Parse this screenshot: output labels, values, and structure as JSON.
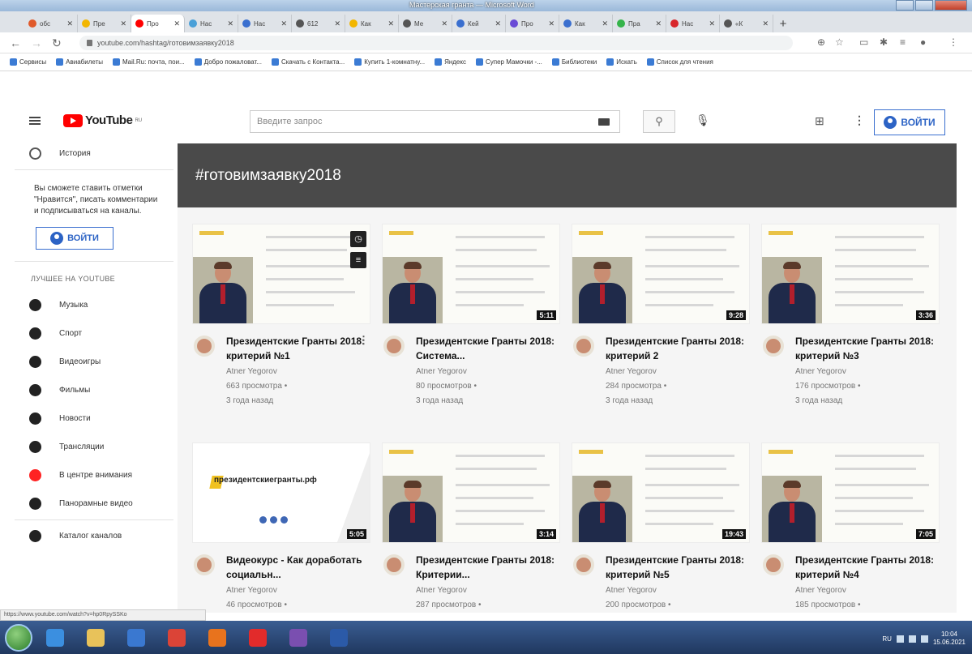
{
  "window": {
    "title": "Мастерская гранта — Microsoft Word"
  },
  "browser_tabs": [
    {
      "label": "oбс",
      "color": "#e05a2b"
    },
    {
      "label": "Пре",
      "color": "#f2b600"
    },
    {
      "label": "Про",
      "color": "#ff0000",
      "active": true
    },
    {
      "label": "Нас",
      "color": "#4aa0d8"
    },
    {
      "label": "Нас",
      "color": "#3a6fcf"
    },
    {
      "label": "612",
      "color": "#555555"
    },
    {
      "label": "Как",
      "color": "#f2b600"
    },
    {
      "label": "Ме",
      "color": "#555555"
    },
    {
      "label": "Кей",
      "color": "#3a6fcf"
    },
    {
      "label": "Про",
      "color": "#6a4bd6"
    },
    {
      "label": "Как",
      "color": "#3a6fcf"
    },
    {
      "label": "Пра",
      "color": "#35b44a"
    },
    {
      "label": "Нас",
      "color": "#d8262b"
    },
    {
      "label": "«К",
      "color": "#555555"
    }
  ],
  "address": {
    "url": "youtube.com/hashtag/готовимзаявку2018"
  },
  "bookmarks": [
    "Сервисы",
    "Авиабилеты",
    "Mail.Ru: почта, пои...",
    "Добро пожаловат...",
    "Скачать с Контакта...",
    "Купить 1-комнатну...",
    "Яндекс",
    "Супер Мамочки -...",
    "Библиотеки",
    "Искать",
    "Список для чтения"
  ],
  "youtube": {
    "logo": "YouTube",
    "logo_region": "RU",
    "search_placeholder": "Введите запрос",
    "login_label": "ВОЙТИ"
  },
  "sidebar": {
    "history_label": "История",
    "signin_text": "Вы сможете ставить отметки \"Нравится\", писать комментарии и подписываться на каналы.",
    "signin_button": "ВОЙТИ",
    "best_header": "ЛУЧШЕЕ НА YOUTUBE",
    "items": [
      {
        "label": "Музыка",
        "icon": "music-icon"
      },
      {
        "label": "Спорт",
        "icon": "sport-icon"
      },
      {
        "label": "Видеоигры",
        "icon": "gaming-icon"
      },
      {
        "label": "Фильмы",
        "icon": "movies-icon"
      },
      {
        "label": "Новости",
        "icon": "news-icon"
      },
      {
        "label": "Трансляции",
        "icon": "live-icon"
      },
      {
        "label": "В центре внимания",
        "icon": "spotlight-icon"
      },
      {
        "label": "Панорамные видео",
        "icon": "360-icon"
      }
    ],
    "catalog_label": "Каталог каналов"
  },
  "hashtag": "#готовимзаявку2018",
  "videos": [
    {
      "title": "Президентские Гранты 2018: критерий №1",
      "channel": "Atner Yegorov",
      "views": "663 просмотра •",
      "age": "3 года назад",
      "duration": ""
    },
    {
      "title": "Президентские Гранты 2018: Система...",
      "channel": "Atner Yegorov",
      "views": "80 просмотров •",
      "age": "3 года назад",
      "duration": "5:11"
    },
    {
      "title": "Президентские Гранты 2018: критерий 2",
      "channel": "Atner Yegorov",
      "views": "284 просмотра •",
      "age": "3 года назад",
      "duration": "9:28"
    },
    {
      "title": "Президентские Гранты 2018: критерий №3",
      "channel": "Atner Yegorov",
      "views": "176 просмотров •",
      "age": "3 года назад",
      "duration": "3:36"
    },
    {
      "title": "Видеокурс - Как доработать социальн...",
      "channel": "Atner Yegorov",
      "views": "46 просмотров •",
      "age": "",
      "duration": "5:05"
    },
    {
      "title": "Президентские Гранты 2018: Критерии...",
      "channel": "Atner Yegorov",
      "views": "287 просмотров •",
      "age": "",
      "duration": "3:14"
    },
    {
      "title": "Президентские Гранты 2018: критерий №5",
      "channel": "Atner Yegorov",
      "views": "200 просмотров •",
      "age": "",
      "duration": "19:43"
    },
    {
      "title": "Президентские Гранты 2018: критерий №4",
      "channel": "Atner Yegorov",
      "views": "185 просмотров •",
      "age": "",
      "duration": "7:05"
    }
  ],
  "promo_slide_text": "президентскиегранты.рф",
  "status_url": "https://www.youtube.com/watch?v=hp0RpySSKo",
  "taskbar": {
    "icons": [
      {
        "name": "ie-icon",
        "color": "#3b8fe0"
      },
      {
        "name": "explorer-icon",
        "color": "#e8c25a"
      },
      {
        "name": "media-icon",
        "color": "#3a78d0"
      },
      {
        "name": "chrome-icon",
        "color": "#db4437"
      },
      {
        "name": "firefox-icon",
        "color": "#e8731d"
      },
      {
        "name": "yandex-icon",
        "color": "#e22b2b"
      },
      {
        "name": "save-icon",
        "color": "#7a4fb0"
      },
      {
        "name": "word-icon",
        "color": "#2b5aa8"
      }
    ],
    "lang": "RU",
    "time": "10:04",
    "date": "15.06.2021"
  }
}
